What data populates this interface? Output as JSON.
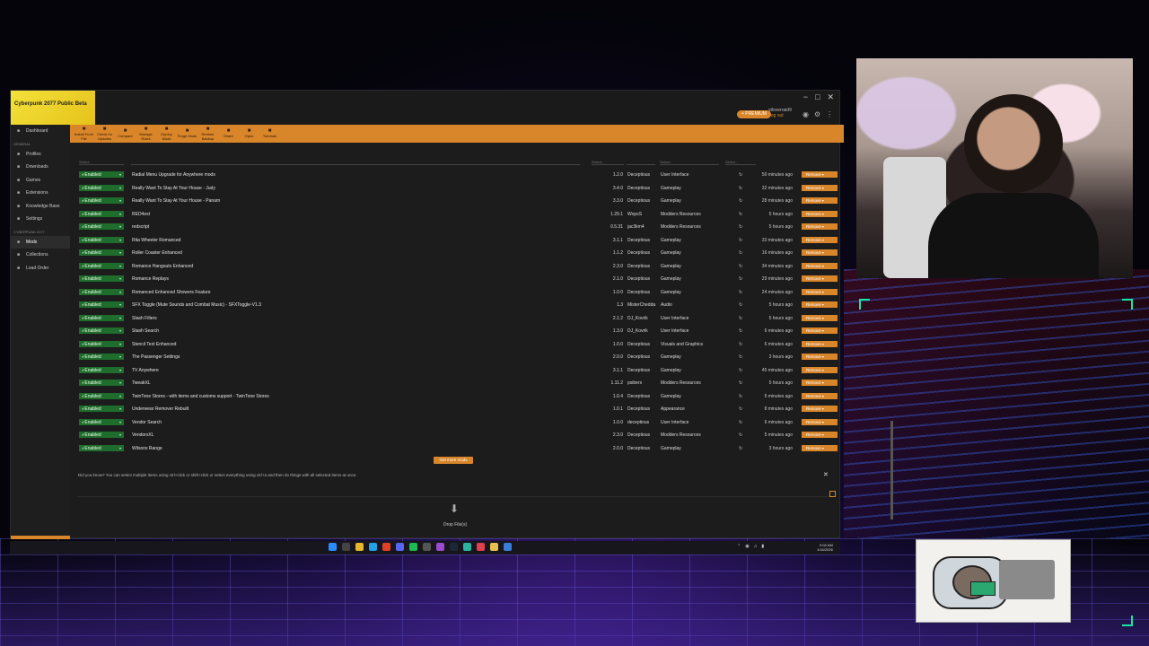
{
  "app": {
    "logo_text": "Cyberpunk 2077 Public Beta",
    "window_controls": [
      "−",
      "□",
      "✕"
    ],
    "premium_label": "+ PREMIUM",
    "username": "stloverraid9",
    "logout_label": "Log out"
  },
  "toolbar": {
    "buttons": [
      {
        "icon": "install-icon",
        "label": "Install From File"
      },
      {
        "icon": "refresh-icon",
        "label": "Check for Updates"
      },
      {
        "icon": "compare-icon",
        "label": "Compare"
      },
      {
        "icon": "manage-icon",
        "label": "Manage Rules"
      },
      {
        "icon": "deploy-icon",
        "label": "Deploy Mods"
      },
      {
        "icon": "purge-icon",
        "label": "Purge Mods"
      },
      {
        "icon": "restore-icon",
        "label": "Restore Backup"
      },
      {
        "icon": "share-icon",
        "label": "Share"
      },
      {
        "icon": "open-icon",
        "label": "Open"
      },
      {
        "icon": "tutorial-icon",
        "label": "Tutorials"
      }
    ]
  },
  "sidebar": {
    "items": [
      {
        "icon": "dashboard-icon",
        "label": "Dashboard"
      },
      {
        "icon": "",
        "label": "GENERAL",
        "heading": true
      },
      {
        "icon": "profiles-icon",
        "label": "Profiles"
      },
      {
        "icon": "downloads-icon",
        "label": "Downloads"
      },
      {
        "icon": "games-icon",
        "label": "Games"
      },
      {
        "icon": "extensions-icon",
        "label": "Extensions"
      },
      {
        "icon": "knowledge-icon",
        "label": "Knowledge Base"
      },
      {
        "icon": "settings-icon",
        "label": "Settings"
      },
      {
        "icon": "",
        "label": "CYBERPUNK 2077",
        "heading": true
      },
      {
        "icon": "mods-icon",
        "label": "Mods",
        "active": true
      },
      {
        "icon": "collections-icon",
        "label": "Collections"
      },
      {
        "icon": "load-order-icon",
        "label": "Load Order"
      }
    ]
  },
  "filters": {
    "status": "Select...",
    "version": "Select...",
    "category": "Select...",
    "updated": "Select..."
  },
  "mods": [
    {
      "status": "Enabled",
      "name": "Radial Menu Upgrade for Anywhere mods",
      "version": "1.2.0",
      "author": "Deceptious",
      "category": "User Interface",
      "updated": "50 minutes ago"
    },
    {
      "status": "Enabled",
      "name": "Really Want To Stay At Your House - Judy",
      "version": "3.4.0",
      "author": "Deceptious",
      "category": "Gameplay",
      "updated": "32 minutes ago"
    },
    {
      "status": "Enabled",
      "name": "Really Want To Stay At Your House - Panam",
      "version": "3.3.0",
      "author": "Deceptious",
      "category": "Gameplay",
      "updated": "28 minutes ago"
    },
    {
      "status": "Enabled",
      "name": "RED4ext",
      "version": "1.29.1",
      "author": "WopsS",
      "category": "Modders Resources",
      "updated": "5 hours ago"
    },
    {
      "status": "Enabled",
      "name": "redscript",
      "version": "0.5.31",
      "author": "jac3km4",
      "category": "Modders Resources",
      "updated": "5 hours ago"
    },
    {
      "status": "Enabled",
      "name": "Rita Wheeler Romanced",
      "version": "3.1.1",
      "author": "Deceptious",
      "category": "Gameplay",
      "updated": "33 minutes ago"
    },
    {
      "status": "Enabled",
      "name": "Roller Coaster Enhanced",
      "version": "1.1.2",
      "author": "Deceptious",
      "category": "Gameplay",
      "updated": "16 minutes ago"
    },
    {
      "status": "Enabled",
      "name": "Romance Hangouts Enhanced",
      "version": "2.3.0",
      "author": "Deceptious",
      "category": "Gameplay",
      "updated": "34 minutes ago"
    },
    {
      "status": "Enabled",
      "name": "Romance Replays",
      "version": "2.1.0",
      "author": "Deceptious",
      "category": "Gameplay",
      "updated": "29 minutes ago"
    },
    {
      "status": "Enabled",
      "name": "Romanced Enhanced Showers Feature",
      "version": "1.0.0",
      "author": "Deceptious",
      "category": "Gameplay",
      "updated": "24 minutes ago"
    },
    {
      "status": "Enabled",
      "name": "SFX Toggle (Mute Sounds and Combat Music) - SFXToggle-V1.3",
      "version": "1.3",
      "author": "MisterChedda",
      "category": "Audio",
      "updated": "5 hours ago"
    },
    {
      "status": "Enabled",
      "name": "Stash Filters",
      "version": "2.1.2",
      "author": "DJ_Kovrik",
      "category": "User Interface",
      "updated": "5 hours ago"
    },
    {
      "status": "Enabled",
      "name": "Stash Search",
      "version": "1.3.0",
      "author": "DJ_Kovrik",
      "category": "User Interface",
      "updated": "6 minutes ago"
    },
    {
      "status": "Enabled",
      "name": "Stencil Text Enhanced",
      "version": "1.0.0",
      "author": "Deceptious",
      "category": "Visuals and Graphics",
      "updated": "6 minutes ago"
    },
    {
      "status": "Enabled",
      "name": "The Passenger Settings",
      "version": "2.0.0",
      "author": "Deceptious",
      "category": "Gameplay",
      "updated": "3 hours ago"
    },
    {
      "status": "Enabled",
      "name": "TV Anywhere",
      "version": "3.1.1",
      "author": "Deceptious",
      "category": "Gameplay",
      "updated": "45 minutes ago"
    },
    {
      "status": "Enabled",
      "name": "TweakXL",
      "version": "1.11.2",
      "author": "psiberx",
      "category": "Modders Resources",
      "updated": "5 hours ago"
    },
    {
      "status": "Enabled",
      "name": "TwinTone Stores - with items and customs support - TwinTone Stores",
      "version": "1.0.4",
      "author": "Deceptious",
      "category": "Gameplay",
      "updated": "5 minutes ago"
    },
    {
      "status": "Enabled",
      "name": "Underwear Remover Rebuilt",
      "version": "1.0.1",
      "author": "Deceptious",
      "category": "Appearance",
      "updated": "8 minutes ago"
    },
    {
      "status": "Enabled",
      "name": "Vendor Search",
      "version": "1.0.0",
      "author": "deceptious",
      "category": "User Interface",
      "updated": "6 minutes ago"
    },
    {
      "status": "Enabled",
      "name": "VendorsXL",
      "version": "2.3.0",
      "author": "Deceptious",
      "category": "Modders Resources",
      "updated": "5 minutes ago"
    },
    {
      "status": "Enabled",
      "name": "Wilsons Range",
      "version": "2.0.0",
      "author": "Deceptious",
      "category": "Gameplay",
      "updated": "3 hours ago"
    }
  ],
  "remove_label": "Remove",
  "get_more_label": "Get more mods",
  "tip_text": "Did you know? You can select multiple items using ctrl+click or shift+click or select everything using ctrl+a and then do things with all selected items at once.",
  "drop_label": "Drop File(s)",
  "clock": {
    "time": "9:02 AM",
    "date": "1/16/2026"
  },
  "colors": {
    "accent": "#d9862b",
    "enabled": "#1f6d2c",
    "background": "#1c1c1c"
  }
}
